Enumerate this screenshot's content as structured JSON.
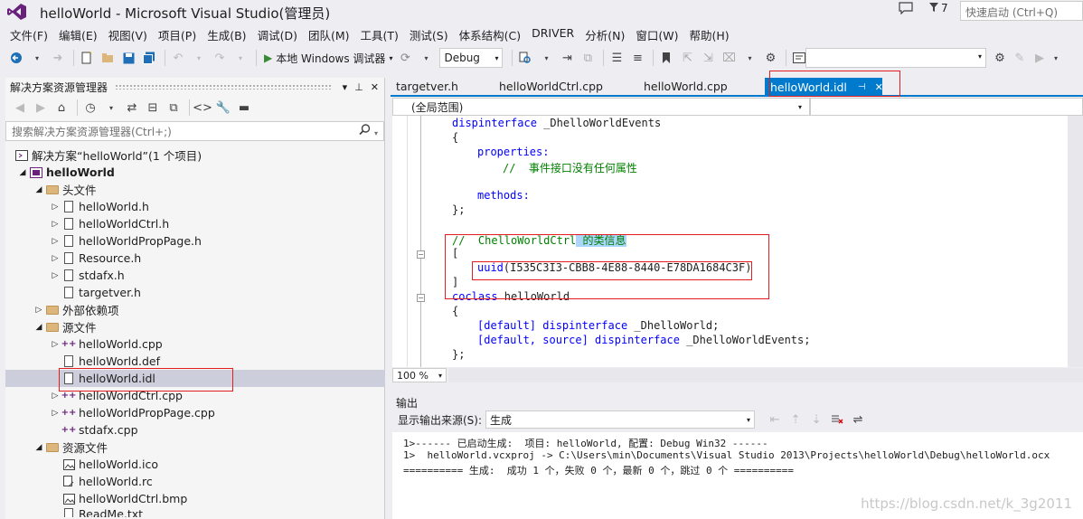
{
  "window": {
    "title": "helloWorld - Microsoft Visual Studio(管理员)",
    "notification_count": "7",
    "quick_launch_placeholder": "快速启动 (Ctrl+Q)"
  },
  "menu": [
    "文件(F)",
    "编辑(E)",
    "视图(V)",
    "项目(P)",
    "生成(B)",
    "调试(D)",
    "团队(M)",
    "工具(T)",
    "测试(S)",
    "体系结构(C)",
    "DRIVER",
    "分析(N)",
    "窗口(W)",
    "帮助(H)"
  ],
  "toolbar": {
    "run_label": "本地 Windows 调试器",
    "config": "Debug"
  },
  "solution_explorer": {
    "title": "解决方案资源管理器",
    "search_placeholder": "搜索解决方案资源管理器(Ctrl+;)",
    "items": [
      {
        "label": "解决方案“helloWorld”(1 个项目)",
        "icon": "solution-icon"
      },
      {
        "label": "helloWorld",
        "icon": "project-icon"
      },
      {
        "label": "头文件",
        "icon": "folder-icon"
      },
      {
        "label": "helloWorld.h",
        "icon": "header-file-icon"
      },
      {
        "label": "helloWorldCtrl.h",
        "icon": "header-file-icon"
      },
      {
        "label": "helloWorldPropPage.h",
        "icon": "header-file-icon"
      },
      {
        "label": "Resource.h",
        "icon": "header-file-icon"
      },
      {
        "label": "stdafx.h",
        "icon": "header-file-icon"
      },
      {
        "label": "targetver.h",
        "icon": "header-file-icon"
      },
      {
        "label": "外部依赖项",
        "icon": "folder-icon"
      },
      {
        "label": "源文件",
        "icon": "folder-icon"
      },
      {
        "label": "helloWorld.cpp",
        "icon": "cpp-file-icon"
      },
      {
        "label": "helloWorld.def",
        "icon": "text-file-icon"
      },
      {
        "label": "helloWorld.idl",
        "icon": "text-file-icon"
      },
      {
        "label": "helloWorldCtrl.cpp",
        "icon": "cpp-file-icon"
      },
      {
        "label": "helloWorldPropPage.cpp",
        "icon": "cpp-file-icon"
      },
      {
        "label": "stdafx.cpp",
        "icon": "cpp-file-icon"
      },
      {
        "label": "资源文件",
        "icon": "folder-icon"
      },
      {
        "label": "helloWorld.ico",
        "icon": "image-file-icon"
      },
      {
        "label": "helloWorld.rc",
        "icon": "resource-file-icon"
      },
      {
        "label": "helloWorldCtrl.bmp",
        "icon": "image-file-icon"
      },
      {
        "label": "ReadMe.txt",
        "icon": "text-file-icon"
      }
    ]
  },
  "editor": {
    "tabs": [
      "targetver.h",
      "helloWorldCtrl.cpp",
      "helloWorld.cpp",
      "helloWorld.idl"
    ],
    "active_tab": "helloWorld.idl",
    "scope": "(全局范围)",
    "zoom": "100 %",
    "code": {
      "l1_kw": "dispinterface",
      "l1_rest": " _DhelloWorldEvents",
      "l2": "{",
      "l3_kw": "properties:",
      "l4_cm": "//  事件接口没有任何属性",
      "l5_kw": "methods:",
      "l6": "};",
      "l7_cm": "//  ChelloWorldCtrl",
      "l7_hl": " 的类信息",
      "l8": "[",
      "l9_kw": "uuid",
      "l9_rest": "(I535C3I3-CBB8-4E88-8440-E78DA1684C3F)",
      "l10": "]",
      "l11_kw": "coclass",
      "l11_rest": " helloWorld",
      "l12": "{",
      "l13_a": "[default]",
      "l13_b": " dispinterface",
      "l13_c": " _DhelloWorld;",
      "l14_a": "[default,",
      "l14_b": " source]",
      "l14_c": " dispinterface",
      "l14_d": " _DhelloWorldEvents;",
      "l15": "};"
    }
  },
  "output": {
    "title": "输出",
    "source_label": "显示输出来源(S):",
    "source_value": "生成",
    "lines": [
      "1>------ 已启动生成:  项目: helloWorld, 配置: Debug Win32 ------",
      "1>  helloWorld.vcxproj -> C:\\Users\\min\\Documents\\Visual Studio 2013\\Projects\\helloWorld\\Debug\\helloWorld.ocx",
      "========== 生成:  成功 1 个，失败 0 个，最新 0 个，跳过 0 个 =========="
    ],
    "watermark": "https://blog.csdn.net/k_3g2011"
  },
  "colors": {
    "accent": "#007acc",
    "annotation": "#e41e1e",
    "keyword": "#0000ff",
    "comment": "#008000"
  }
}
